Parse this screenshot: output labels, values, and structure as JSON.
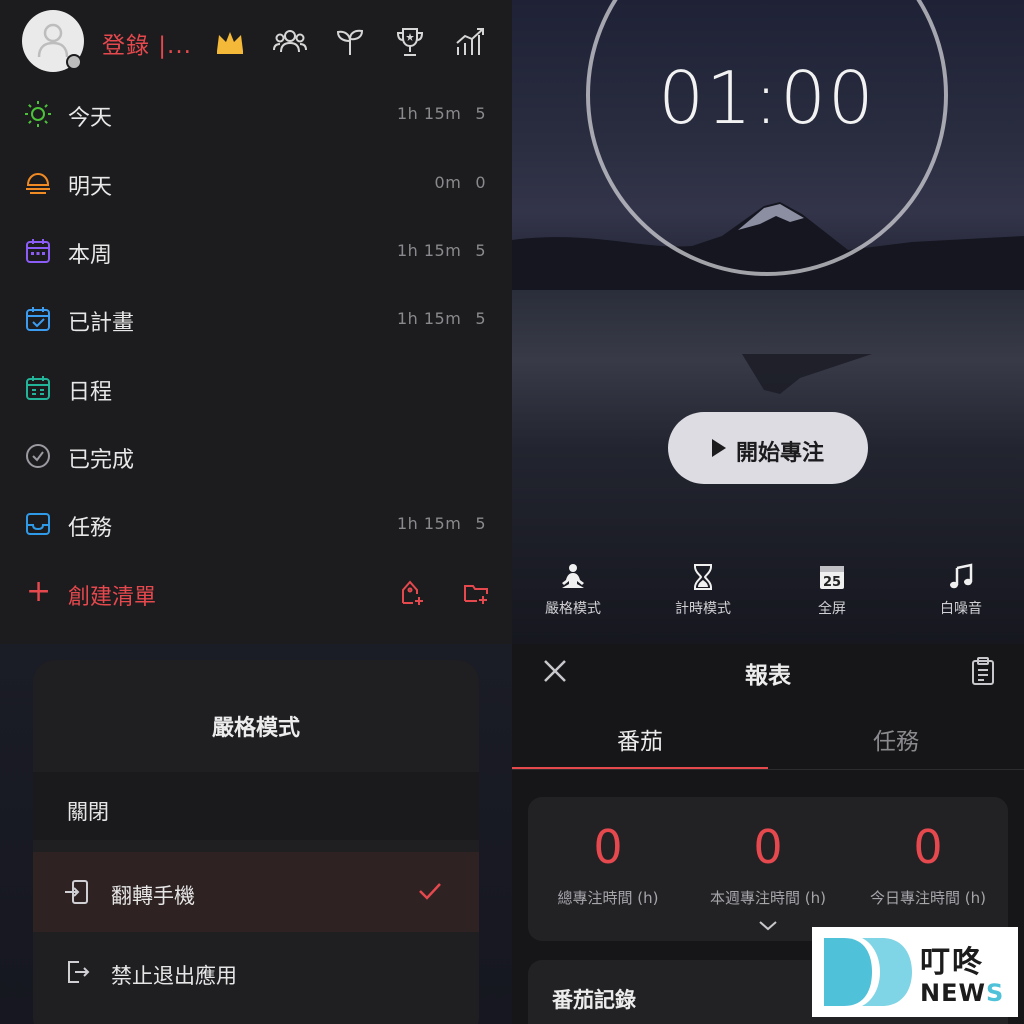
{
  "header": {
    "login_text": "登錄 |..."
  },
  "lists": [
    {
      "label": "今天",
      "time": "1h 15m",
      "count": "5"
    },
    {
      "label": "明天",
      "time": "0m",
      "count": "0"
    },
    {
      "label": "本周",
      "time": "1h 15m",
      "count": "5"
    },
    {
      "label": "已計畫",
      "time": "1h 15m",
      "count": "5"
    },
    {
      "label": "日程",
      "time": "",
      "count": ""
    },
    {
      "label": "已完成",
      "time": "",
      "count": ""
    },
    {
      "label": "任務",
      "time": "1h 15m",
      "count": "5"
    }
  ],
  "create_list_label": "創建清單",
  "timer": {
    "display": "01:00",
    "start_label": "開始專注",
    "tools": [
      {
        "label": "嚴格模式",
        "icon": "meditation-icon"
      },
      {
        "label": "計時模式",
        "icon": "hourglass-icon"
      },
      {
        "label": "全屏",
        "icon": "calendar-25-icon"
      },
      {
        "label": "白噪音",
        "icon": "music-note-icon"
      }
    ]
  },
  "strict_mode": {
    "title": "嚴格模式",
    "options": [
      {
        "label": "關閉",
        "selected": false
      },
      {
        "label": "翻轉手機",
        "selected": true,
        "icon": "flip-phone-icon"
      },
      {
        "label": "禁止退出應用",
        "selected": false,
        "icon": "exit-app-icon"
      }
    ]
  },
  "report": {
    "title": "報表",
    "tabs": [
      "番茄",
      "任務"
    ],
    "active_tab": "番茄",
    "stats": [
      {
        "value": "0",
        "caption": "總專注時間 (h)"
      },
      {
        "value": "0",
        "caption": "本週專注時間 (h)"
      },
      {
        "value": "0",
        "caption": "今日專注時間 (h)"
      }
    ],
    "records_title": "番茄記錄"
  },
  "watermark": {
    "line1": "叮咚",
    "line2_prefix": "NEW",
    "line2_suffix": "S"
  },
  "colors": {
    "accent_red": "#e5484d",
    "today_green": "#4cc13a",
    "tomorrow_orange": "#f08a24",
    "week_purple": "#8b5cf6",
    "planned_blue": "#3b9cf0",
    "schedule_teal": "#22b59a",
    "done_gray": "#9a9aa0",
    "tasks_blue": "#2f9be8",
    "crown_gold": "#f5b93a"
  }
}
